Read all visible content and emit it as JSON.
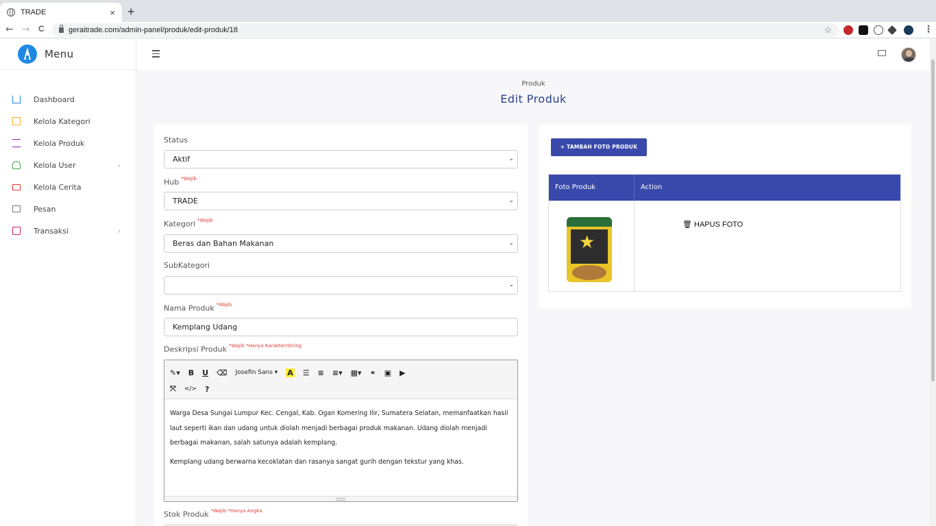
{
  "browser": {
    "tab_title": "TRADE",
    "tab_close": "×",
    "new_tab": "+",
    "url": "geraitrade.com/admin-panel/produk/edit-produk/18",
    "back": "←",
    "forward": "→",
    "reload": "C",
    "bookmark": "☆"
  },
  "sidebar": {
    "brand": "Menu",
    "items": [
      {
        "label": "Dashboard",
        "icon": "home-icon",
        "color": "#1e88e5"
      },
      {
        "label": "Kelola Kategori",
        "icon": "layers-icon",
        "color": "#f9a825"
      },
      {
        "label": "Kelola Produk",
        "icon": "cart-icon",
        "color": "#8e24aa"
      },
      {
        "label": "Kelola User",
        "icon": "user-icon",
        "color": "#43a047",
        "chevron": "›"
      },
      {
        "label": "Kelola Cerita",
        "icon": "monitor-icon",
        "color": "#e53935"
      },
      {
        "label": "Pesan",
        "icon": "mail-icon",
        "color": "#757575"
      },
      {
        "label": "Transaksi",
        "icon": "bag-icon",
        "color": "#d81b60",
        "chevron": "›"
      }
    ]
  },
  "header": {
    "breadcrumb": "Produk",
    "title": "Edit Produk"
  },
  "form": {
    "status": {
      "label": "Status",
      "value": "Aktif"
    },
    "hub": {
      "label": "Hub",
      "required": "*Wajib",
      "value": "TRADE"
    },
    "kategori": {
      "label": "Kategori",
      "required": "*Wajib",
      "value": "Beras dan Bahan Makanan"
    },
    "subkategori": {
      "label": "SubKategori",
      "value": ""
    },
    "nama": {
      "label": "Nama Produk",
      "required": "*Wajib",
      "value": "Kemplang Udang"
    },
    "deskripsi": {
      "label": "Deskripsi Produk",
      "required": "*Wajib *Hanya Karakter/String",
      "font_name": "Josefin Sans ▾",
      "paragraph1": "Warga Desa Sungai Lumpur Kec. Cengal, Kab. Ogan Komering Ilir, Sumatera Selatan, memanfaatkan hasil laut seperti ikan dan udang untuk diolah menjadi berbagai produk makanan. Udang diolah menjadi berbagai makanan, salah satunya adalah kemplang.",
      "paragraph2": "Kemplang udang berwarna kecoklatan dan rasanya sangat gurih dengan tekstur yang khas."
    },
    "stok": {
      "label": "Stok Produk",
      "required": "*Wajib *Hanya Angka"
    }
  },
  "photos": {
    "add_button": "+ TAMBAH FOTO PRODUK",
    "col_photo": "Foto Produk",
    "col_action": "Action",
    "delete_label": "🗑 HAPUS FOTO"
  },
  "colors": {
    "accent": "#3949ab",
    "title": "#2a3f8f",
    "required": "#e53935"
  }
}
